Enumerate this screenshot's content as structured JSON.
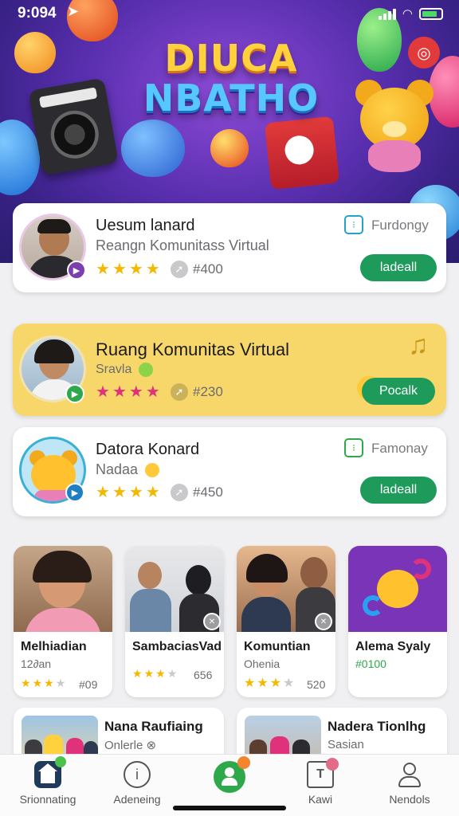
{
  "status": {
    "time": "9:094"
  },
  "hero": {
    "title_line1": "DIUCA",
    "title_line2": "NBATHO"
  },
  "cards": [
    {
      "name": "Uesum lanard",
      "subtitle": "Reangn Komunitass Virtual",
      "price": "#400",
      "corner_label": "Furdongy",
      "button": "ladeall",
      "stars": 4,
      "colors": {
        "badge": "#7b3fb0",
        "corner": "#26a2c9"
      }
    },
    {
      "name": "Ruang Komunitas Virtual",
      "subtitle": "Sravla",
      "price": "#230",
      "button": "Pocalk",
      "stars": 4,
      "colors": {
        "badge": "#2ea84a",
        "stars": "#e0327a",
        "background": "#f7d76a"
      }
    },
    {
      "name": "Datora Konard",
      "subtitle": "Nadaa",
      "price": "#450",
      "corner_label": "Famonay",
      "button": "ladeall",
      "stars": 4,
      "colors": {
        "badge": "#1e7fc4",
        "corner": "#2ea84a"
      }
    }
  ],
  "tiles": [
    {
      "title": "Melhiadian",
      "subtitle": "12∂an",
      "price": "#09",
      "stars": 3
    },
    {
      "title": "SambaciasVad",
      "subtitle": "",
      "price": "656",
      "stars": 3
    },
    {
      "title": "Komuntian",
      "subtitle": "Ohenia",
      "price": "520",
      "stars": 3
    },
    {
      "title": "Alema Syaly",
      "subtitle": "#0100",
      "price": "",
      "stars": 0
    }
  ],
  "wide_cards": [
    {
      "title": "Nana Raufiaing",
      "subtitle": "Onlerle"
    },
    {
      "title": "Nadera Tionlhg",
      "subtitle": "Sasian"
    }
  ],
  "tabs": [
    {
      "label": "Srionnating",
      "icon": "home-icon"
    },
    {
      "label": "Adeneing",
      "icon": "info-icon"
    },
    {
      "label": "",
      "icon": "chat-person-icon"
    },
    {
      "label": "Kawi",
      "icon": "text-box-icon"
    },
    {
      "label": "Nendols",
      "icon": "profile-icon"
    }
  ],
  "colors": {
    "accent_green": "#1e9a5b",
    "star_yellow": "#f5b800",
    "star_pink": "#e0327a"
  }
}
